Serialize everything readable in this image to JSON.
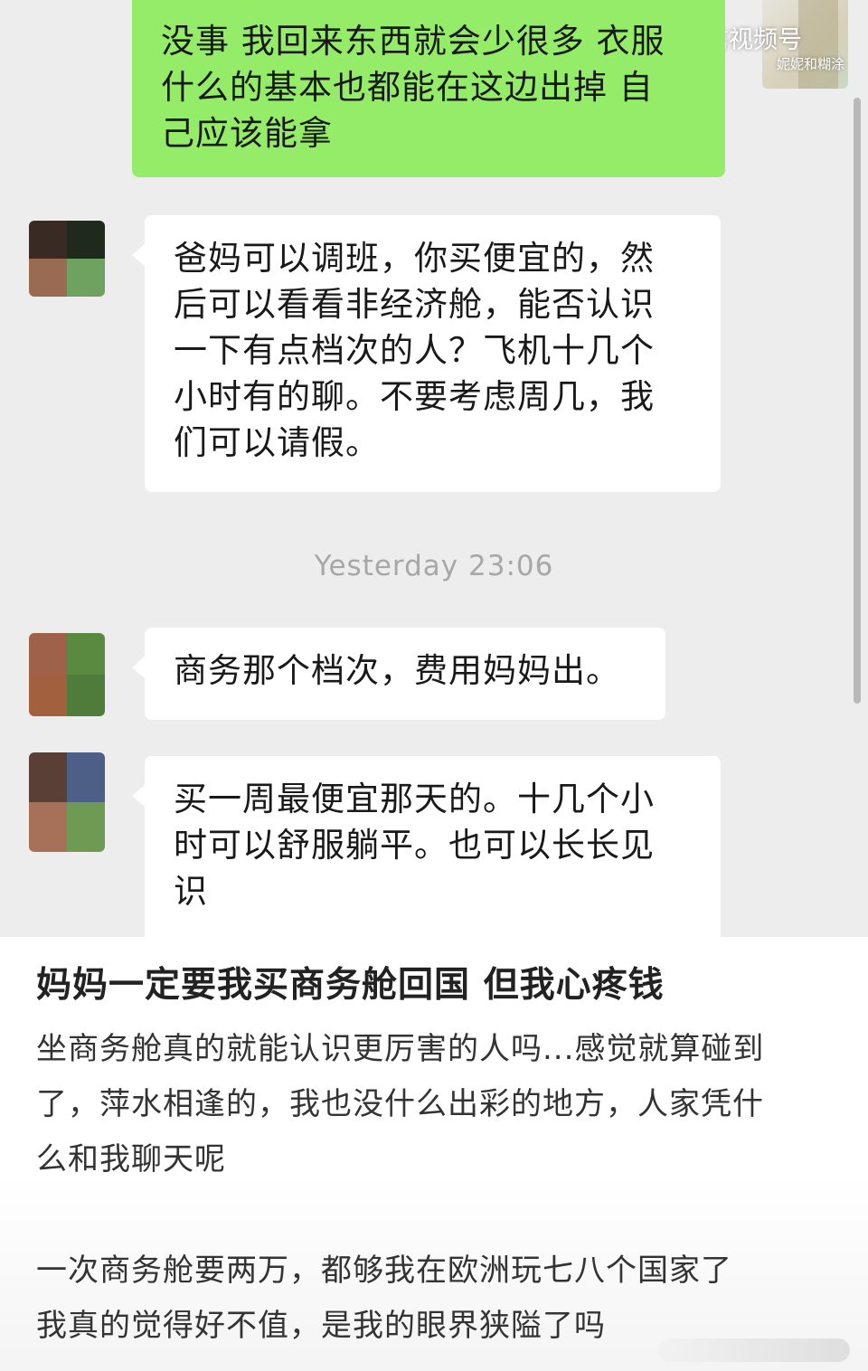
{
  "watermark": {
    "brand": "微信视频号",
    "handle": "妮妮和糊涂"
  },
  "messages": [
    {
      "side": "me",
      "lines": [
        "没事 我回来东西就会少很多 衣服",
        "什么的基本也都能在这边出掉 自",
        "己应该能拿"
      ]
    },
    {
      "side": "other",
      "lines": [
        "爸妈可以调班，你买便宜的，然",
        "后可以看看非经济舱，能否认识",
        "一下有点档次的人？飞机十几个",
        "小时有的聊。不要考虑周几，我",
        "们可以请假。"
      ]
    },
    {
      "side": "other",
      "lines": [
        "商务那个档次，费用妈妈出。"
      ]
    },
    {
      "side": "other",
      "lines": [
        "买一周最便宜那天的。十几个小",
        "时可以舒服躺平。也可以长长见",
        "识"
      ]
    }
  ],
  "timestamp": "Yesterday 23:06",
  "post": {
    "title": "妈妈一定要我买商务舱回国 但我心疼钱",
    "paragraph1": [
      "坐商务舱真的就能认识更厉害的人吗...感觉就算碰到",
      "了，萍水相逢的，我也没什么出彩的地方，人家凭什",
      "么和我聊天呢"
    ],
    "paragraph2": [
      "一次商务舱要两万，都够我在欧洲玩七八个国家了",
      "我真的觉得好不值，是我的眼界狭隘了吗"
    ]
  },
  "colors": {
    "chat_background": "#ededed",
    "my_bubble": "#95ec69",
    "other_bubble": "#ffffff",
    "timestamp_text": "#a7a7a7"
  }
}
